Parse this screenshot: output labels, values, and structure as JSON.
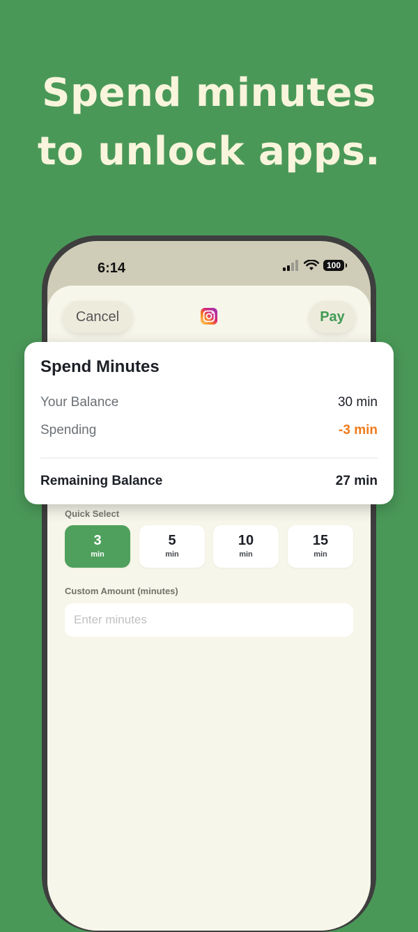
{
  "headline": {
    "line1": "Spend minutes",
    "line2": "to unlock apps."
  },
  "status_bar": {
    "time": "6:14",
    "battery": "100"
  },
  "sheet": {
    "cancel_label": "Cancel",
    "pay_label": "Pay",
    "app_icon": "instagram-icon"
  },
  "summary": {
    "title": "Spend Minutes",
    "balance_label": "Your Balance",
    "balance_value": "30 min",
    "spending_label": "Spending",
    "spending_value": "-3 min",
    "remaining_label": "Remaining Balance",
    "remaining_value": "27 min"
  },
  "quick_select": {
    "label": "Quick Select",
    "options": [
      {
        "value": "3",
        "unit": "min",
        "selected": true
      },
      {
        "value": "5",
        "unit": "min",
        "selected": false
      },
      {
        "value": "10",
        "unit": "min",
        "selected": false
      },
      {
        "value": "15",
        "unit": "min",
        "selected": false
      }
    ]
  },
  "custom": {
    "label": "Custom Amount (minutes)",
    "placeholder": "Enter minutes",
    "value": ""
  },
  "colors": {
    "background": "#4a9858",
    "accent": "#4ea05c",
    "spending": "#f07a1a",
    "headline": "#f8f5dc"
  }
}
